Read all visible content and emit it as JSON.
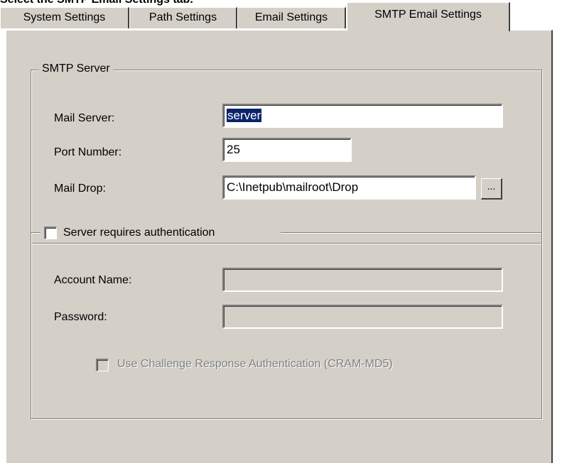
{
  "caption": "Select the SMTP Email Settings tab.",
  "tabs": [
    {
      "label": "System Settings"
    },
    {
      "label": "Path Settings"
    },
    {
      "label": "Email Settings"
    },
    {
      "label": "SMTP Email Settings",
      "selected": true
    }
  ],
  "smtp_server": {
    "legend": "SMTP Server",
    "mail_server": {
      "label": "Mail Server:",
      "value": "server"
    },
    "port_number": {
      "label": "Port Number:",
      "value": "25"
    },
    "mail_drop": {
      "label": "Mail Drop:",
      "value": "C:\\Inetpub\\mailroot\\Drop",
      "browse_label": "..."
    }
  },
  "authentication": {
    "checkbox_label": "Server requires authentication",
    "checked": false,
    "account_name": {
      "label": "Account Name:",
      "value": ""
    },
    "password": {
      "label": "Password:",
      "value": ""
    },
    "cram_md5": {
      "label": "Use Challenge Response Authentication (CRAM-MD5)",
      "checked": false,
      "enabled": false
    }
  },
  "colors": {
    "face": "#d4d0c8",
    "selection": "#0a246a"
  }
}
